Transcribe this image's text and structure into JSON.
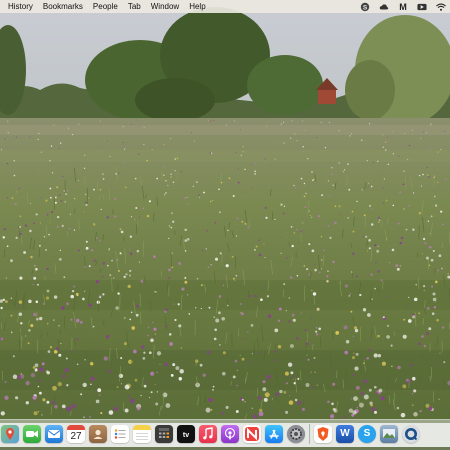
{
  "menubar": {
    "items": [
      "History",
      "Bookmarks",
      "People",
      "Tab",
      "Window",
      "Help"
    ],
    "status_icons": [
      "skype-icon",
      "cloud-icon",
      "malwarebytes-icon",
      "media-icon",
      "wifi-icon"
    ],
    "status_labels": {
      "skype": "S",
      "malwarebytes": "M"
    }
  },
  "wallpaper": {
    "description_colors": {
      "sky": "#c7ccd3",
      "trees": "#3f5a2d",
      "meadow": "#6e8048",
      "flower_purple": "#8a3f8f",
      "flower_white": "#f2f0ea",
      "flower_yellow": "#d9c455"
    }
  },
  "dock": {
    "apps": [
      {
        "name": "maps-app-icon",
        "label": ""
      },
      {
        "name": "facetime-app-icon",
        "label": ""
      },
      {
        "name": "mail-app-icon",
        "label": ""
      },
      {
        "name": "calendar-app-icon",
        "label": "27"
      },
      {
        "name": "contacts-app-icon",
        "label": ""
      },
      {
        "name": "reminders-app-icon",
        "label": ""
      },
      {
        "name": "notes-app-icon",
        "label": ""
      },
      {
        "name": "calculator-app-icon",
        "label": ""
      },
      {
        "name": "apple-tv-app-icon",
        "label": "tv"
      },
      {
        "name": "music-app-icon",
        "label": ""
      },
      {
        "name": "podcasts-app-icon",
        "label": ""
      },
      {
        "name": "news-app-icon",
        "label": ""
      },
      {
        "name": "app-store-app-icon",
        "label": ""
      },
      {
        "name": "system-preferences-app-icon",
        "label": ""
      },
      {
        "name": "brave-browser-app-icon",
        "label": ""
      },
      {
        "name": "word-app-icon",
        "label": "W"
      },
      {
        "name": "skype-app-icon",
        "label": "S"
      },
      {
        "name": "preview-app-icon",
        "label": ""
      },
      {
        "name": "quicktime-app-icon",
        "label": ""
      }
    ]
  }
}
